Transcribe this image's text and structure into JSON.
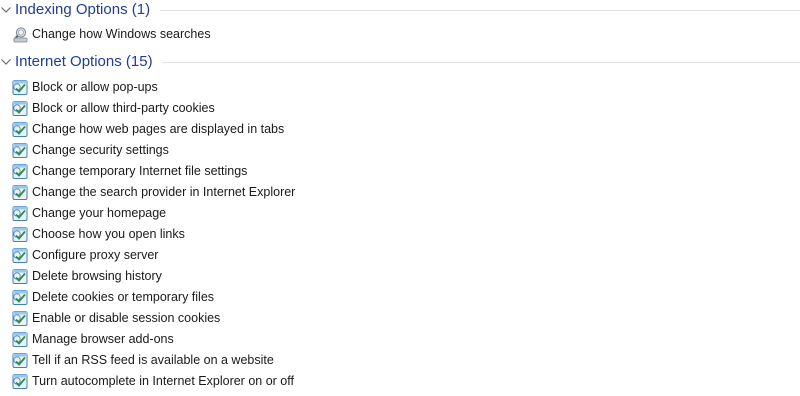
{
  "groups": [
    {
      "title": "Indexing Options (1)",
      "items": [
        {
          "label": "Change how Windows searches",
          "icon": "indexing-options-icon"
        }
      ]
    },
    {
      "title": "Internet Options (15)",
      "items": [
        {
          "label": "Block or allow pop-ups",
          "icon": "internet-options-icon"
        },
        {
          "label": "Block or allow third-party cookies",
          "icon": "internet-options-icon"
        },
        {
          "label": "Change how web pages are displayed in tabs",
          "icon": "internet-options-icon"
        },
        {
          "label": "Change security settings",
          "icon": "internet-options-icon"
        },
        {
          "label": "Change temporary Internet file settings",
          "icon": "internet-options-icon"
        },
        {
          "label": "Change the search provider in Internet Explorer",
          "icon": "internet-options-icon"
        },
        {
          "label": "Change your homepage",
          "icon": "internet-options-icon"
        },
        {
          "label": "Choose how you open links",
          "icon": "internet-options-icon"
        },
        {
          "label": "Configure proxy server",
          "icon": "internet-options-icon"
        },
        {
          "label": "Delete browsing history",
          "icon": "internet-options-icon"
        },
        {
          "label": "Delete cookies or temporary files",
          "icon": "internet-options-icon"
        },
        {
          "label": "Enable or disable session cookies",
          "icon": "internet-options-icon"
        },
        {
          "label": "Manage browser add-ons",
          "icon": "internet-options-icon"
        },
        {
          "label": "Tell if an RSS feed is available on a website",
          "icon": "internet-options-icon"
        },
        {
          "label": "Turn autocomplete in Internet Explorer on or off",
          "icon": "internet-options-icon"
        }
      ]
    }
  ],
  "colors": {
    "group_title": "#1f3d99",
    "item_text": "#1a1a1a",
    "rule": "#e3e3e3"
  }
}
